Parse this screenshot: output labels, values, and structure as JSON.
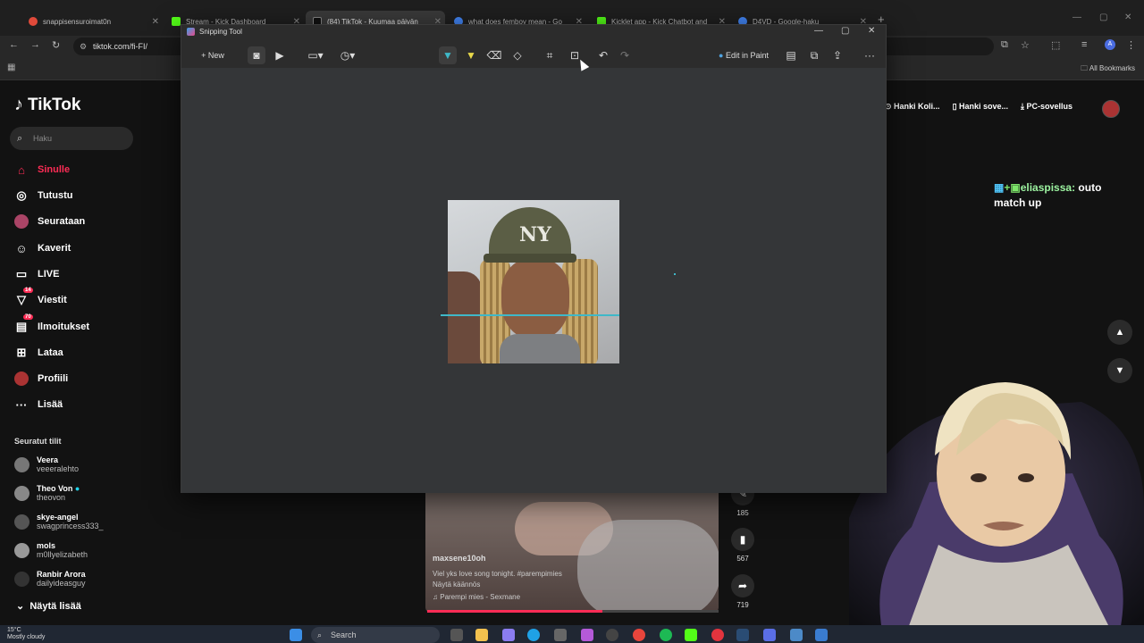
{
  "browser": {
    "tabs": [
      {
        "title": "snappisensuroimat0n",
        "color": "#e04a3a"
      },
      {
        "title": "Stream - Kick Dashboard",
        "color": "#53fc18"
      },
      {
        "title": "(84) TikTok - Kuumaa päivän",
        "color": "#ffffff"
      },
      {
        "title": "what does femboy mean - Go",
        "color": "#4285f4"
      },
      {
        "title": "Kicklet app - Kick Chatbot and",
        "color": "#53fc18"
      },
      {
        "title": "D4VD - Google-haku",
        "color": "#4285f4"
      }
    ],
    "url": "tiktok.com/fi-FI/",
    "all_bookmarks": "All Bookmarks"
  },
  "tiktok": {
    "logo": "TikTok",
    "search_placeholder": "Haku",
    "nav": [
      {
        "label": "Sinulle",
        "icon": "home-icon",
        "active": true
      },
      {
        "label": "Tutustu",
        "icon": "compass-icon"
      },
      {
        "label": "Seurataan",
        "icon": "following-icon"
      },
      {
        "label": "Kaverit",
        "icon": "friends-icon"
      },
      {
        "label": "LIVE",
        "icon": "live-icon"
      },
      {
        "label": "Viestit",
        "icon": "messages-icon",
        "badge": "14"
      },
      {
        "label": "Ilmoitukset",
        "icon": "notifications-icon",
        "badge": "70"
      },
      {
        "label": "Lataa",
        "icon": "upload-icon"
      },
      {
        "label": "Profiili",
        "icon": "profile-icon"
      },
      {
        "label": "Lisää",
        "icon": "more-icon"
      }
    ],
    "followed_title": "Seuratut tilit",
    "followed": [
      {
        "name": "Veera",
        "handle": "veeeralehto"
      },
      {
        "name": "Theo Von",
        "handle": "theovon"
      },
      {
        "name": "skye-angel",
        "handle": "swagprincess333_"
      },
      {
        "name": "mols",
        "handle": "m0llyelizabeth"
      },
      {
        "name": "Ranbir Arora",
        "handle": "dailyideasguy"
      }
    ],
    "show_more": "Näytä lisää",
    "top_actions": [
      "Hanki Koli...",
      "Hanki sove...",
      "PC-sovellus"
    ],
    "video": {
      "user": "maxsene10oh",
      "desc": "Viel yks love song tonight. #parempimies",
      "desc2": "Näytä käännös",
      "music": "Parempi mies - Sexmane",
      "progress": 0.6
    },
    "actions": [
      {
        "icon": "comment-icon",
        "count": "185"
      },
      {
        "icon": "bookmark-icon",
        "count": "567"
      },
      {
        "icon": "share-icon",
        "count": "719"
      }
    ]
  },
  "stream_chat": {
    "user": "eliaspissa:",
    "message": "outo match up"
  },
  "snipping_tool": {
    "title": "Snipping Tool",
    "new_label": "New",
    "edit_in_paint": "Edit in Paint"
  },
  "taskbar": {
    "temperature": "15°C",
    "weather": "Mostly cloudy",
    "search_placeholder": "Search"
  }
}
